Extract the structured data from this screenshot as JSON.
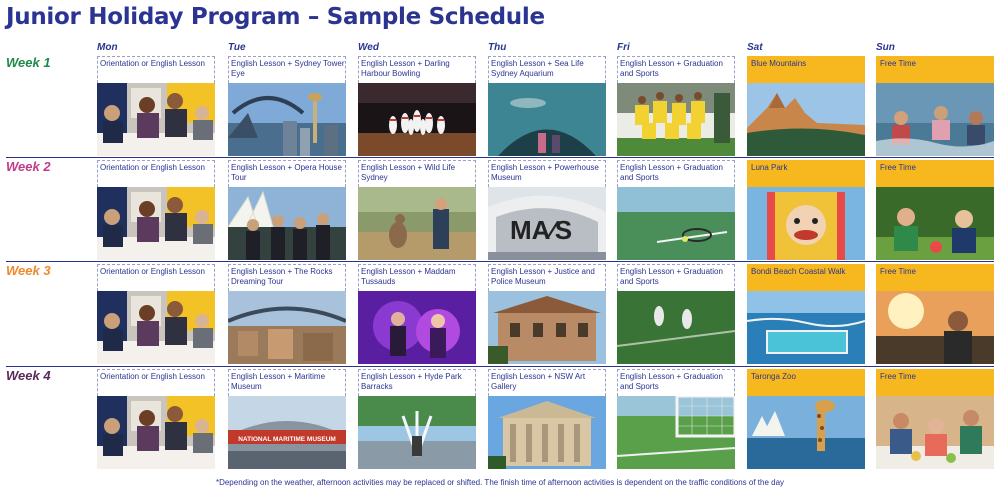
{
  "title": "Junior Holiday Program – Sample Schedule",
  "days": [
    "Mon",
    "Tue",
    "Wed",
    "Thu",
    "Fri",
    "Sat",
    "Sun"
  ],
  "weeks": [
    {
      "label": "Week 1",
      "color": "#1f8a4c",
      "activities": [
        "Orientation or English Lesson",
        "English Lesson + Sydney Tower Eye",
        "English Lesson + Darling Harbour Bowling",
        "English Lesson + Sea Life Sydney Aquarium",
        "English Lesson + Graduation and Sports",
        "Blue Mountains",
        "Free Time"
      ]
    },
    {
      "label": "Week 2",
      "color": "#c23b8a",
      "activities": [
        "Orientation or English Lesson",
        "English Lesson + Opera House Tour",
        "English Lesson + Wild Life Sydney",
        "English Lesson + Powerhouse Museum",
        "English Lesson + Graduation and Sports",
        "Luna Park",
        "Free Time"
      ]
    },
    {
      "label": "Week 3",
      "color": "#f0892a",
      "activities": [
        "Orientation or English Lesson",
        "English Lesson + The Rocks Dreaming Tour",
        "English Lesson + Maddam Tussauds",
        "English Lesson + Justice and Police Museum",
        "English Lesson + Graduation and Sports",
        "Bondi Beach Coastal Walk",
        "Free Time"
      ]
    },
    {
      "label": "Week 4",
      "color": "#5b2a57",
      "activities": [
        "Orientation or English Lesson",
        "English Lesson + Maritime Museum",
        "English Lesson + Hyde Park Barracks",
        "English Lesson + NSW Art Gallery",
        "English Lesson + Graduation and Sports",
        "Taronga Zoo",
        "Free Time"
      ]
    }
  ],
  "photo_signs": {
    "mas": "MA∕S",
    "national_maritime_museum": "NATIONAL MARITIME MUSEUM"
  },
  "footnote": "*Depending on the weather, afternoon activities may be replaced or shifted. The finish time of afternoon activities is dependent on the traffic conditions of the day",
  "colors": {
    "title": "#2b3491",
    "weekend": "#f7b81f"
  }
}
